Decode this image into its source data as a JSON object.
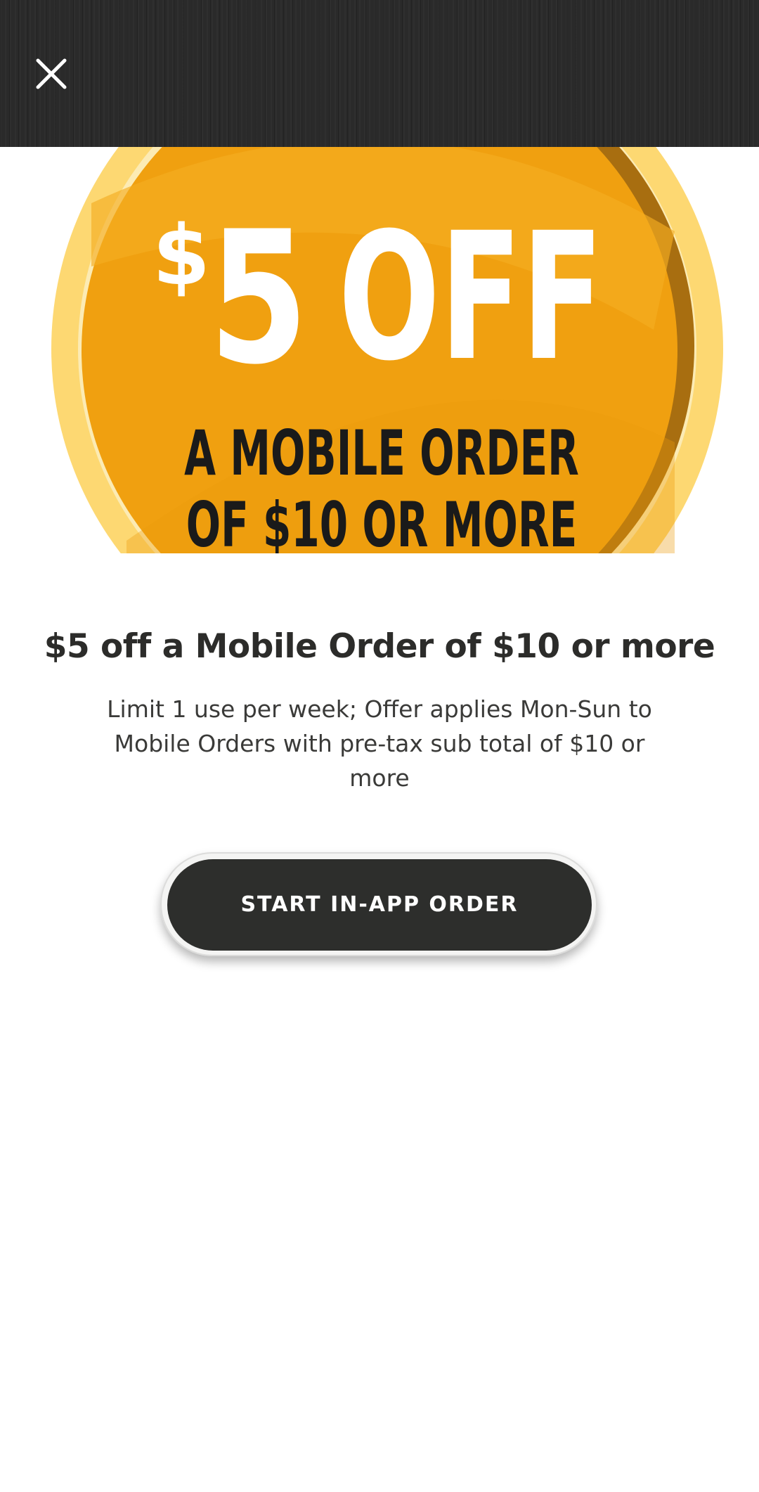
{
  "header": {
    "close_icon": "close-icon"
  },
  "hero": {
    "amount": "5",
    "currency_symbol": "$",
    "off_text": "OFF",
    "line1": "A MOBILE ORDER",
    "line2": "OF $10 OR MORE",
    "colors": {
      "outer_ring": "#fdd872",
      "inner_disc": "#f0a010",
      "text_white": "#ffffff",
      "text_dark": "#1a1a1a"
    }
  },
  "offer": {
    "title": "$5 off a Mobile Order of $10 or more",
    "description": "Limit 1 use per week; Offer applies Mon-Sun to Mobile Orders with pre-tax sub total of $10 or more"
  },
  "cta": {
    "label": "START IN-APP ORDER"
  }
}
